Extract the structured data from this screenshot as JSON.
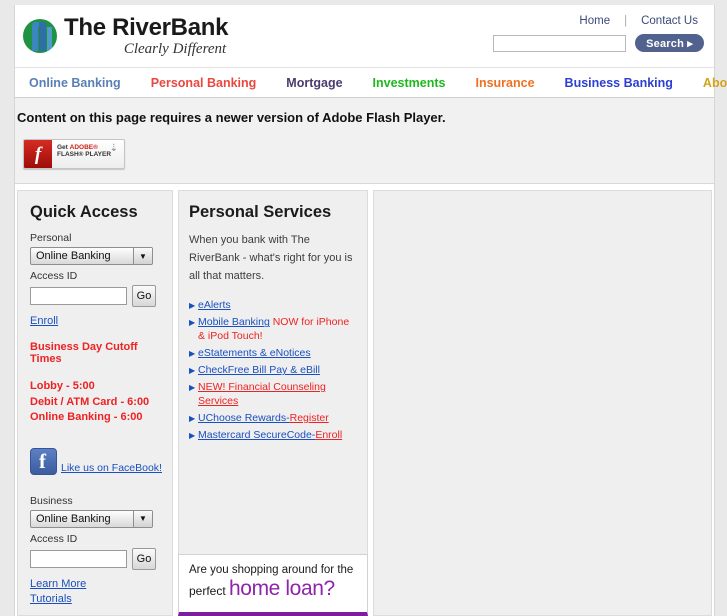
{
  "header": {
    "logo_name": "The RiverBank",
    "logo_tagline": "Clearly Different",
    "util_links": [
      {
        "label": "Home"
      },
      {
        "label": "Contact Us"
      }
    ],
    "util_separator": "|",
    "search": {
      "value": "",
      "placeholder": "",
      "button_label": "Search ▸"
    }
  },
  "mainnav": {
    "items": [
      {
        "label": "Online Banking",
        "color": "#5a7fb5"
      },
      {
        "label": "Personal Banking",
        "color": "#e8483f"
      },
      {
        "label": "Mortgage",
        "color": "#4a3b6e"
      },
      {
        "label": "Investments",
        "color": "#1db81d"
      },
      {
        "label": "Insurance",
        "color": "#f07020"
      },
      {
        "label": "Business Banking",
        "color": "#2d3fd0"
      },
      {
        "label": "About Us",
        "color": "#d3a41b"
      }
    ]
  },
  "flash_notice": {
    "message": "Content on this page requires a newer version of Adobe Flash Player.",
    "badge": {
      "glyph": "f",
      "line1_prefix": "Get ",
      "line1_brand": "ADOBE®",
      "line2": "FLASH® PLAYER",
      "arrow": "⬇"
    }
  },
  "quick_access": {
    "title": "Quick Access",
    "personal": {
      "section_label": "Personal",
      "select_value": "Online Banking",
      "select_arrow": "▼",
      "access_id_label": "Access ID",
      "access_id_value": "",
      "go_label": "Go",
      "enroll_label": "Enroll"
    },
    "cutoff": {
      "heading": "Business Day Cutoff Times",
      "times": [
        "Lobby - 5:00",
        "Debit / ATM Card - 6:00",
        "Online Banking - 6:00"
      ]
    },
    "facebook": {
      "glyph": "f",
      "link_label": "Like us on FaceBook!"
    },
    "business": {
      "section_label": "Business",
      "select_value": "Online Banking",
      "select_arrow": "▼",
      "access_id_label": "Access ID",
      "access_id_value": "",
      "go_label": "Go",
      "learn_more_label": "Learn More",
      "tutorials_label": "Tutorials"
    }
  },
  "personal_services": {
    "title": "Personal Services",
    "blurb": "When you bank with The RiverBank - what's right for you is all that matters.",
    "bullet": "▶",
    "links": [
      {
        "link_text": "eAlerts",
        "trailing_red": ""
      },
      {
        "link_text": "Mobile Banking",
        "trailing_red": " NOW for iPhone & iPod Touch!"
      },
      {
        "link_text": "eStatements & eNotices",
        "trailing_red": ""
      },
      {
        "link_text": "CheckFree Bill Pay & eBill",
        "trailing_red": ""
      },
      {
        "link_text": "NEW! Financial Counseling Services",
        "trailing_red": ""
      },
      {
        "link_text": "UChoose Rewards-",
        "red_link_text": "Register"
      },
      {
        "link_text": "Mastercard SecureCode-",
        "red_link_text": "Enroll"
      }
    ]
  },
  "promo": {
    "line1": "Are you shopping around for the",
    "line2_small": "perfect ",
    "line2_big": "home loan?",
    "accent_color": "#7b1f9e"
  }
}
